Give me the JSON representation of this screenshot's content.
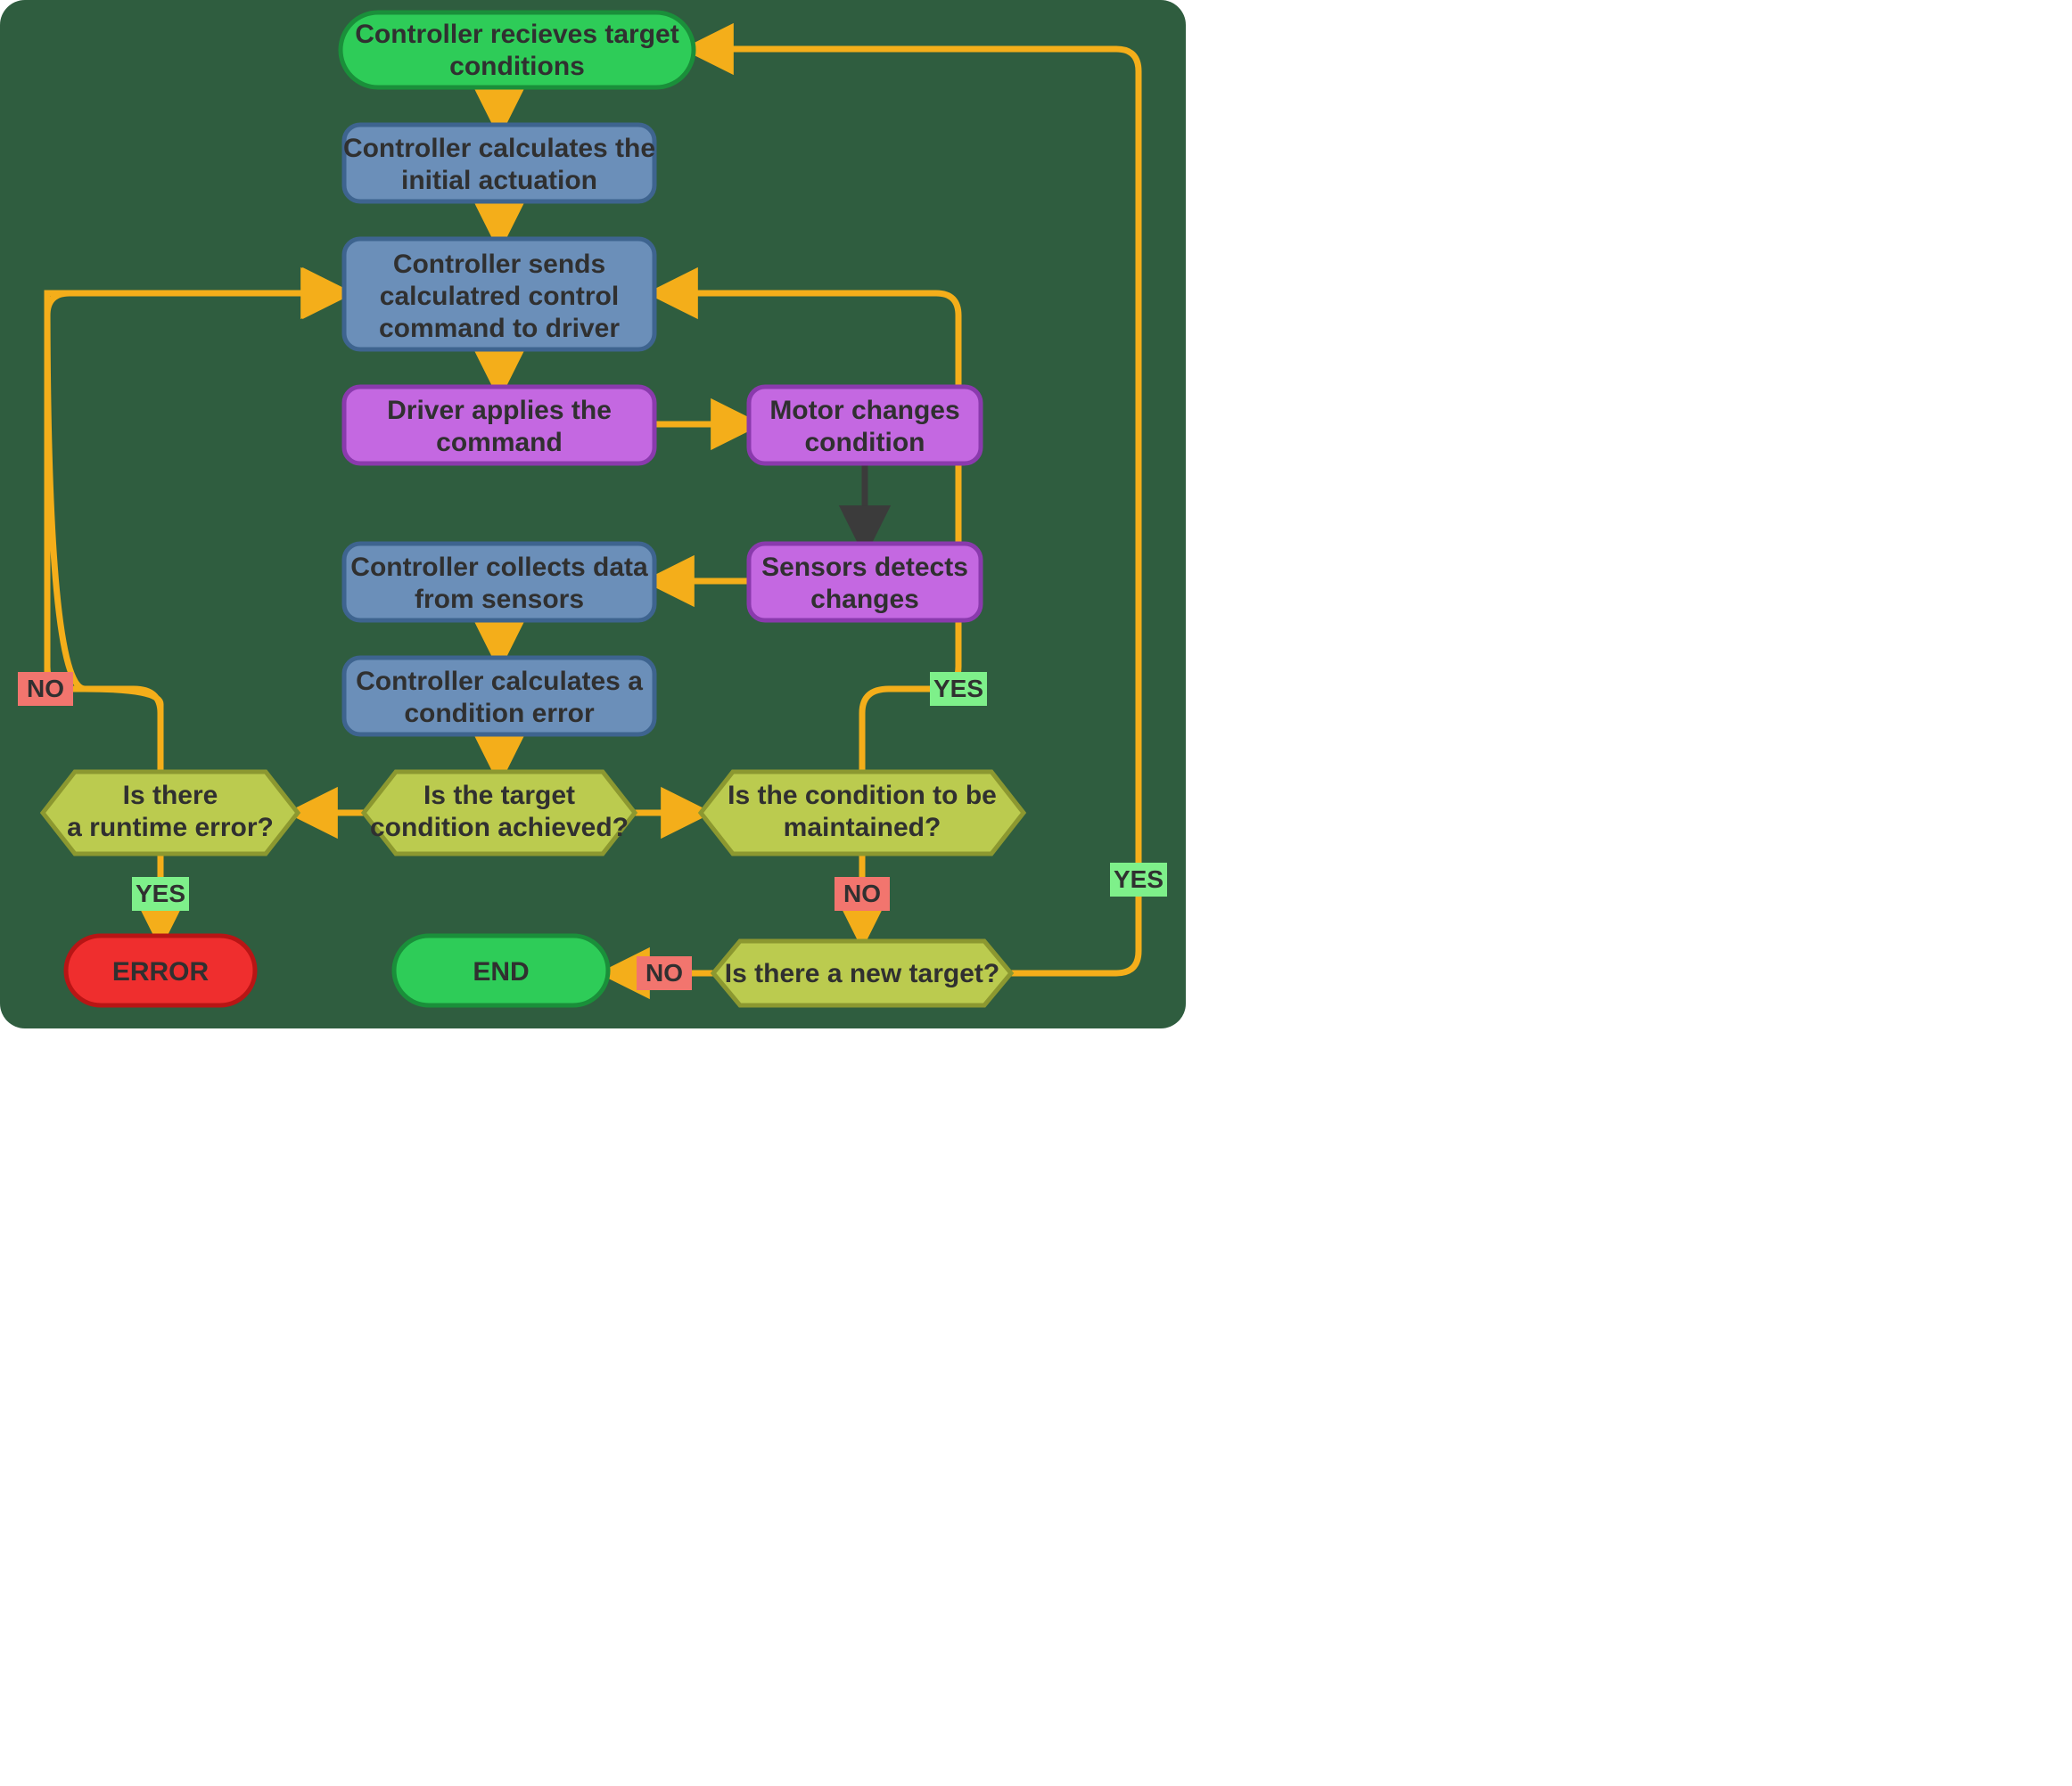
{
  "colors": {
    "bg": "#2f5d3f",
    "arrow": "#f4ae1a",
    "darkArrow": "#3b3b3b",
    "green": "#2ecc58",
    "greenStroke": "#1a8f3a",
    "blue": "#6b8fb9",
    "blueStroke": "#3e648f",
    "purple": "#c468e1",
    "purpleStroke": "#8a3aad",
    "olive": "#bbcb4f",
    "oliveStroke": "#8c9830",
    "red": "#ef2e2e",
    "redStroke": "#b81515",
    "yesBg": "#7ef08a",
    "noBg": "#f2756e"
  },
  "nodes": {
    "start": {
      "line1": "Controller recieves target",
      "line2": "conditions"
    },
    "calcInit": {
      "line1": "Controller calculates the",
      "line2": "initial actuation"
    },
    "send": {
      "line1": "Controller sends",
      "line2": "calculatred control",
      "line3": "command to driver"
    },
    "driver": {
      "line1": "Driver applies the",
      "line2": "command"
    },
    "motor": {
      "line1": "Motor changes",
      "line2": "condition"
    },
    "sensors": {
      "line1": "Sensors detects",
      "line2": "changes"
    },
    "collect": {
      "line1": "Controller collects data",
      "line2": "from sensors"
    },
    "calcErr": {
      "line1": "Controller calculates a",
      "line2": "condition error"
    },
    "decTarget": {
      "line1": "Is the target",
      "line2": "condition achieved?"
    },
    "decRuntime": {
      "line1": "Is there",
      "line2": "a runtime error?"
    },
    "decMaintain": {
      "line1": "Is the condition to be",
      "line2": "maintained?"
    },
    "decNewTarget": {
      "line1": "Is there a new target?"
    },
    "error": "ERROR",
    "end": "END"
  },
  "labels": {
    "yes": "YES",
    "no": "NO"
  }
}
